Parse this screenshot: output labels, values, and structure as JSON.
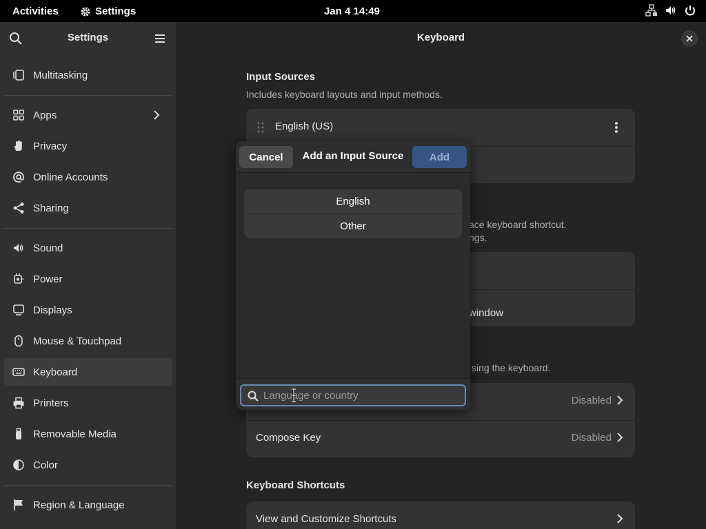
{
  "topbar": {
    "activities": "Activities",
    "app_name": "Settings",
    "clock": "Jan 4  14:49"
  },
  "sidebar": {
    "title": "Settings",
    "items": [
      {
        "label": "Multitasking",
        "icon": "multitasking-icon"
      },
      {
        "label": "Apps",
        "icon": "apps-icon"
      },
      {
        "label": "Privacy",
        "icon": "hand-icon"
      },
      {
        "label": "Online Accounts",
        "icon": "at-icon"
      },
      {
        "label": "Sharing",
        "icon": "share-icon"
      },
      {
        "label": "Sound",
        "icon": "speaker-icon"
      },
      {
        "label": "Power",
        "icon": "power-icon"
      },
      {
        "label": "Displays",
        "icon": "display-icon"
      },
      {
        "label": "Mouse & Touchpad",
        "icon": "mouse-icon"
      },
      {
        "label": "Keyboard",
        "icon": "keyboard-icon",
        "active": true
      },
      {
        "label": "Printers",
        "icon": "printer-icon"
      },
      {
        "label": "Removable Media",
        "icon": "usb-icon"
      },
      {
        "label": "Color",
        "icon": "color-icon"
      },
      {
        "label": "Region & Language",
        "icon": "flag-icon"
      }
    ]
  },
  "main": {
    "title": "Keyboard",
    "input_sources": {
      "title": "Input Sources",
      "subtitle": "Includes keyboard layouts and input methods.",
      "source": "English (US)"
    },
    "switching": {
      "subtitle_fragment_1": "ace keyboard shortcut.",
      "subtitle_fragment_2": "ngs.",
      "row_fragment": "window"
    },
    "special": {
      "subtitle_fragment": "sing the keyboard.",
      "row1_value": "Disabled",
      "row2_label": "Compose Key",
      "row2_value": "Disabled"
    },
    "shortcuts": {
      "title": "Keyboard Shortcuts",
      "row_label": "View and Customize Shortcuts"
    }
  },
  "dialog": {
    "cancel": "Cancel",
    "title": "Add an Input Source",
    "add": "Add",
    "items": [
      "English",
      "Other"
    ],
    "search_placeholder": "Language or country",
    "search_value": ""
  },
  "colors": {
    "accent": "#365585",
    "focus_ring": "#6a86b5"
  }
}
